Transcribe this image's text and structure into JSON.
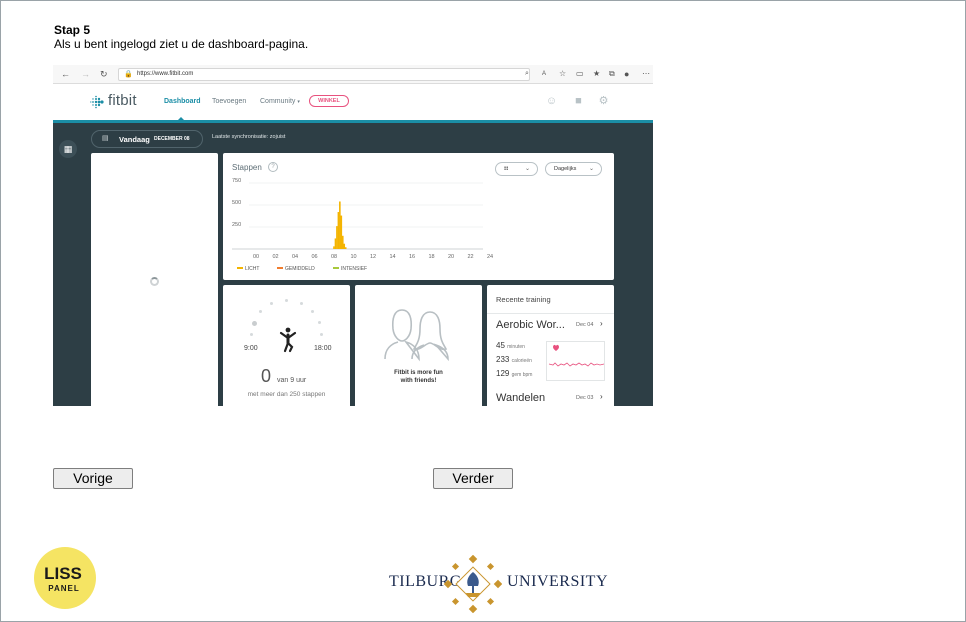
{
  "step": {
    "title": "Stap 5",
    "description": "Als u bent ingelogd ziet u de dashboard-pagina."
  },
  "browser": {
    "url": "https://www.fitbit.com"
  },
  "fitbit": {
    "logo": "fitbit",
    "nav": [
      "Dashboard",
      "Toevoegen",
      "Community",
      "WINKEL"
    ],
    "date_today": "Vandaag",
    "date_month": "DECEMBER 08",
    "sync_text": "Laatste synchronisatie: zojuist",
    "steps_tile": {
      "title": "Stappen",
      "help": "?",
      "period_select": "Dagelijks"
    },
    "goal_tile": {
      "time_start": "9:00",
      "time_end": "18:00",
      "count": "0",
      "of_hours": "van 9 uur",
      "subtitle": "met meer dan 250 stappen"
    },
    "friends_tile": {
      "line1": "Fitbit is more fun",
      "line2": "with friends!"
    },
    "training_tile": {
      "title": "Recente training",
      "items": [
        {
          "name": "Aerobic Wor...",
          "date": "Dec 04"
        },
        {
          "name": "Wandelen",
          "date": "Dec 03"
        }
      ],
      "stats": [
        {
          "value": "45",
          "unit": "minuten"
        },
        {
          "value": "233",
          "unit": "calorieën"
        },
        {
          "value": "129",
          "unit": "gem bpm"
        }
      ]
    }
  },
  "chart_data": {
    "type": "bar",
    "title": "Stappen",
    "x_ticks": [
      "00",
      "02",
      "04",
      "06",
      "08",
      "10",
      "12",
      "14",
      "16",
      "18",
      "20",
      "22",
      "24"
    ],
    "y_ticks": [
      750,
      500,
      250
    ],
    "ylim": [
      0,
      750
    ],
    "xlim": [
      0,
      24
    ],
    "legend": [
      "LICHT",
      "GEMIDDELD",
      "INTENSIEF"
    ],
    "legend_colors": [
      "#f4b400",
      "#f07d2e",
      "#a8c93c"
    ],
    "bar_color": "#f4b400",
    "x": [
      8.0,
      8.15,
      8.3,
      8.45,
      8.6,
      8.75,
      8.9,
      9.05,
      9.2
    ],
    "values": [
      30,
      120,
      260,
      420,
      540,
      380,
      150,
      60,
      20
    ]
  },
  "buttons": {
    "prev": "Vorige",
    "next": "Verder"
  },
  "footer": {
    "liss_line1": "LISS",
    "liss_line2": "PANEL",
    "tilburg_left": "TILBURG",
    "tilburg_right": "UNIVERSITY"
  },
  "colors": {
    "fitbit_teal": "#1b8ea6",
    "dashboard_bg": "#2d3e45",
    "liss_yellow": "#f5e463",
    "tilburg_navy": "#1a2a4e",
    "tilburg_gold": "#c9952e"
  }
}
